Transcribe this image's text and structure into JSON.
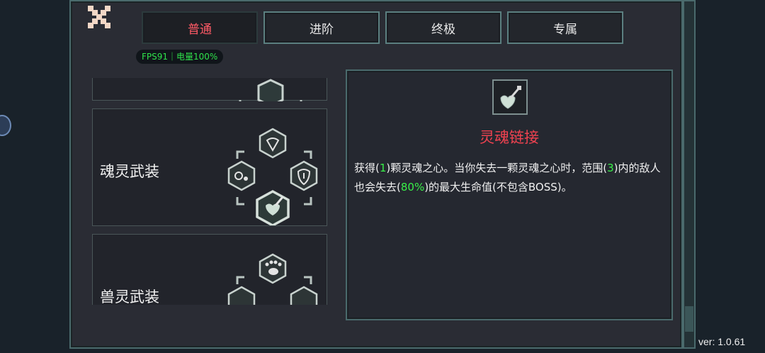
{
  "tabs": [
    {
      "label": "普通",
      "active": true
    },
    {
      "label": "进阶",
      "active": false
    },
    {
      "label": "终极",
      "active": false
    },
    {
      "label": "专属",
      "active": false
    }
  ],
  "fps_badge": "FPS91｜电量100%",
  "cards": [
    {
      "name": ""
    },
    {
      "name": "魂灵武装"
    },
    {
      "name": "兽灵武装"
    }
  ],
  "detail": {
    "title": "灵魂链接",
    "desc_parts": [
      "获得(",
      "1",
      ")颗灵魂之心。当你失去一颗灵魂之心时，范围(",
      "3",
      ")内的敌人也会失去(",
      "80%",
      ")的最大生命值(不包含BOSS)。"
    ]
  },
  "version": "ver: 1.0.61",
  "icons": {
    "close": "close-x-icon",
    "detail": "soul-heart-link-icon"
  },
  "colors": {
    "active_tab": "#ff5a66",
    "title_red": "#f04250",
    "highlight_green": "#38f048",
    "fps_green": "#2fe24b",
    "border_teal": "#4a6a6c"
  }
}
